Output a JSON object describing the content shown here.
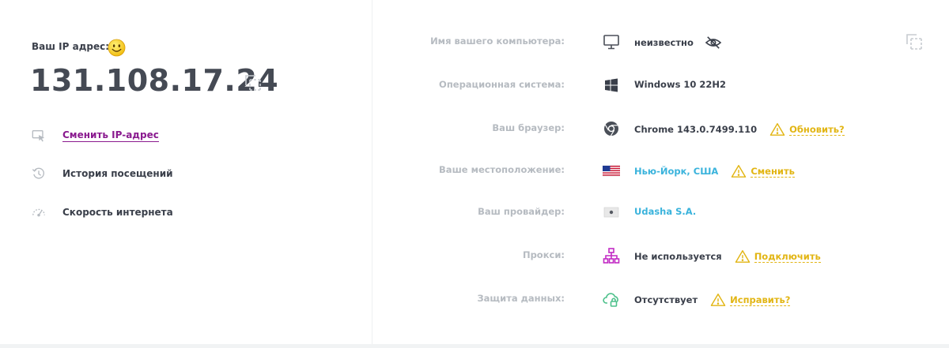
{
  "left": {
    "ip_label": "Ваш IP адрес:",
    "ip_address": "131.108.17.24",
    "menu": [
      {
        "label": "Сменить IP-адрес",
        "icon": "screen-arrow-icon"
      },
      {
        "label": "История посещений",
        "icon": "history-clock-icon"
      },
      {
        "label": "Скорость интернета",
        "icon": "speedometer-icon"
      }
    ]
  },
  "info": {
    "computer": {
      "label": "Имя вашего компьютера:",
      "value": "неизвестно"
    },
    "os": {
      "label": "Операционная система:",
      "value": "Windows 10 22H2"
    },
    "browser": {
      "label": "Ваш браузер:",
      "value": "Chrome 143.0.7499.110",
      "action": "Обновить?"
    },
    "location": {
      "label": "Ваше местоположение:",
      "value": "Нью-Йорк, США",
      "action": "Сменить"
    },
    "provider": {
      "label": "Ваш провайдер:",
      "value": "Udasha S.A."
    },
    "proxy": {
      "label": "Прокси:",
      "value": "Не используется",
      "action": "Подключить"
    },
    "protection": {
      "label": "Защита данных:",
      "value": "Отсутствует",
      "action": "Исправить?"
    }
  },
  "colors": {
    "label_gray": "#b6bbc1",
    "text_dark": "#3a3f4a",
    "link_purple": "#8a1a8f",
    "accent_blue": "#3ab3dc",
    "warning_yellow": "#e2b513",
    "proxy_magenta": "#c22bc4",
    "protection_green": "#4cc08a"
  }
}
